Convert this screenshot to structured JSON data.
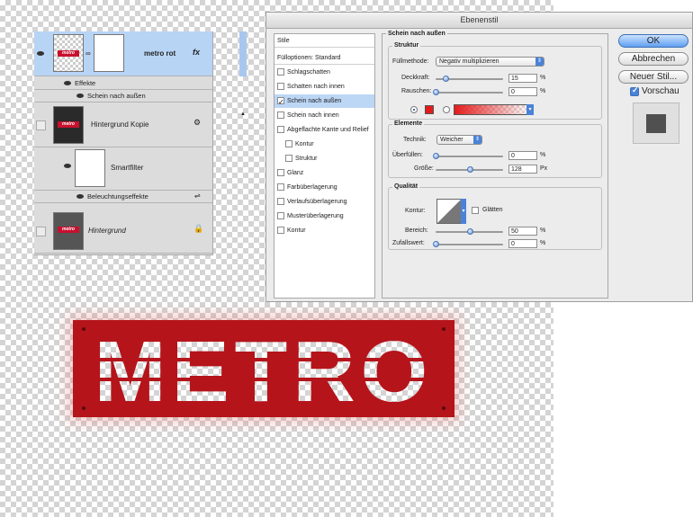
{
  "layers": {
    "rows": [
      {
        "name": "metro rot",
        "fx": "fx"
      },
      {
        "name": "Effekte"
      },
      {
        "name": "Schein nach außen"
      },
      {
        "name": "Hintergrund Kopie"
      },
      {
        "name": "Smartfilter"
      },
      {
        "name": "Beleuchtungseffekte"
      },
      {
        "name": "Hintergrund"
      }
    ],
    "thumb_text": "metro"
  },
  "dialog": {
    "title": "Ebenenstil",
    "styles": {
      "stile": "Stile",
      "fulloptionen": "Fülloptionen: Standard",
      "items": [
        {
          "label": "Schlagschatten",
          "checked": false
        },
        {
          "label": "Schatten nach innen",
          "checked": false
        },
        {
          "label": "Schein nach außen",
          "checked": true
        },
        {
          "label": "Schein nach innen",
          "checked": false
        },
        {
          "label": "Abgeflachte Kante und Relief",
          "checked": false
        },
        {
          "label": "Kontur",
          "checked": false
        },
        {
          "label": "Struktur",
          "checked": false
        },
        {
          "label": "Glanz",
          "checked": false
        },
        {
          "label": "Farbüberlagerung",
          "checked": false
        },
        {
          "label": "Verlaufsüberlagerung",
          "checked": false
        },
        {
          "label": "Musterüberlagerung",
          "checked": false
        },
        {
          "label": "Kontur",
          "checked": false
        }
      ]
    },
    "panel": {
      "section_title": "Schein nach außen",
      "struktur": {
        "title": "Struktur",
        "fullmethode_label": "Füllmethode:",
        "fullmethode_value": "Negativ multiplizieren",
        "deckkraft_label": "Deckkraft:",
        "deckkraft_value": "15",
        "rauschen_label": "Rauschen:",
        "rauschen_value": "0",
        "unit": "%"
      },
      "elemente": {
        "title": "Elemente",
        "technik_label": "Technik:",
        "technik_value": "Weicher",
        "uberfullen_label": "Überfüllen:",
        "uberfullen_value": "0",
        "grosse_label": "Größe:",
        "grosse_value": "128",
        "unit_pct": "%",
        "unit_px": "Px"
      },
      "qualitat": {
        "title": "Qualität",
        "kontur_label": "Kontur:",
        "glatten_label": "Glätten",
        "bereich_label": "Bereich:",
        "bereich_value": "50",
        "zufallswert_label": "Zufallswert:",
        "zufallswert_value": "0",
        "unit": "%"
      }
    },
    "buttons": {
      "ok": "OK",
      "abbrechen": "Abbrechen",
      "neuer_stil": "Neuer Stil...",
      "vorschau": "Vorschau"
    },
    "glow_color": "#e41b1b"
  },
  "canvas": {
    "sign_text": "METRO",
    "sign_color": "#b5141b"
  }
}
